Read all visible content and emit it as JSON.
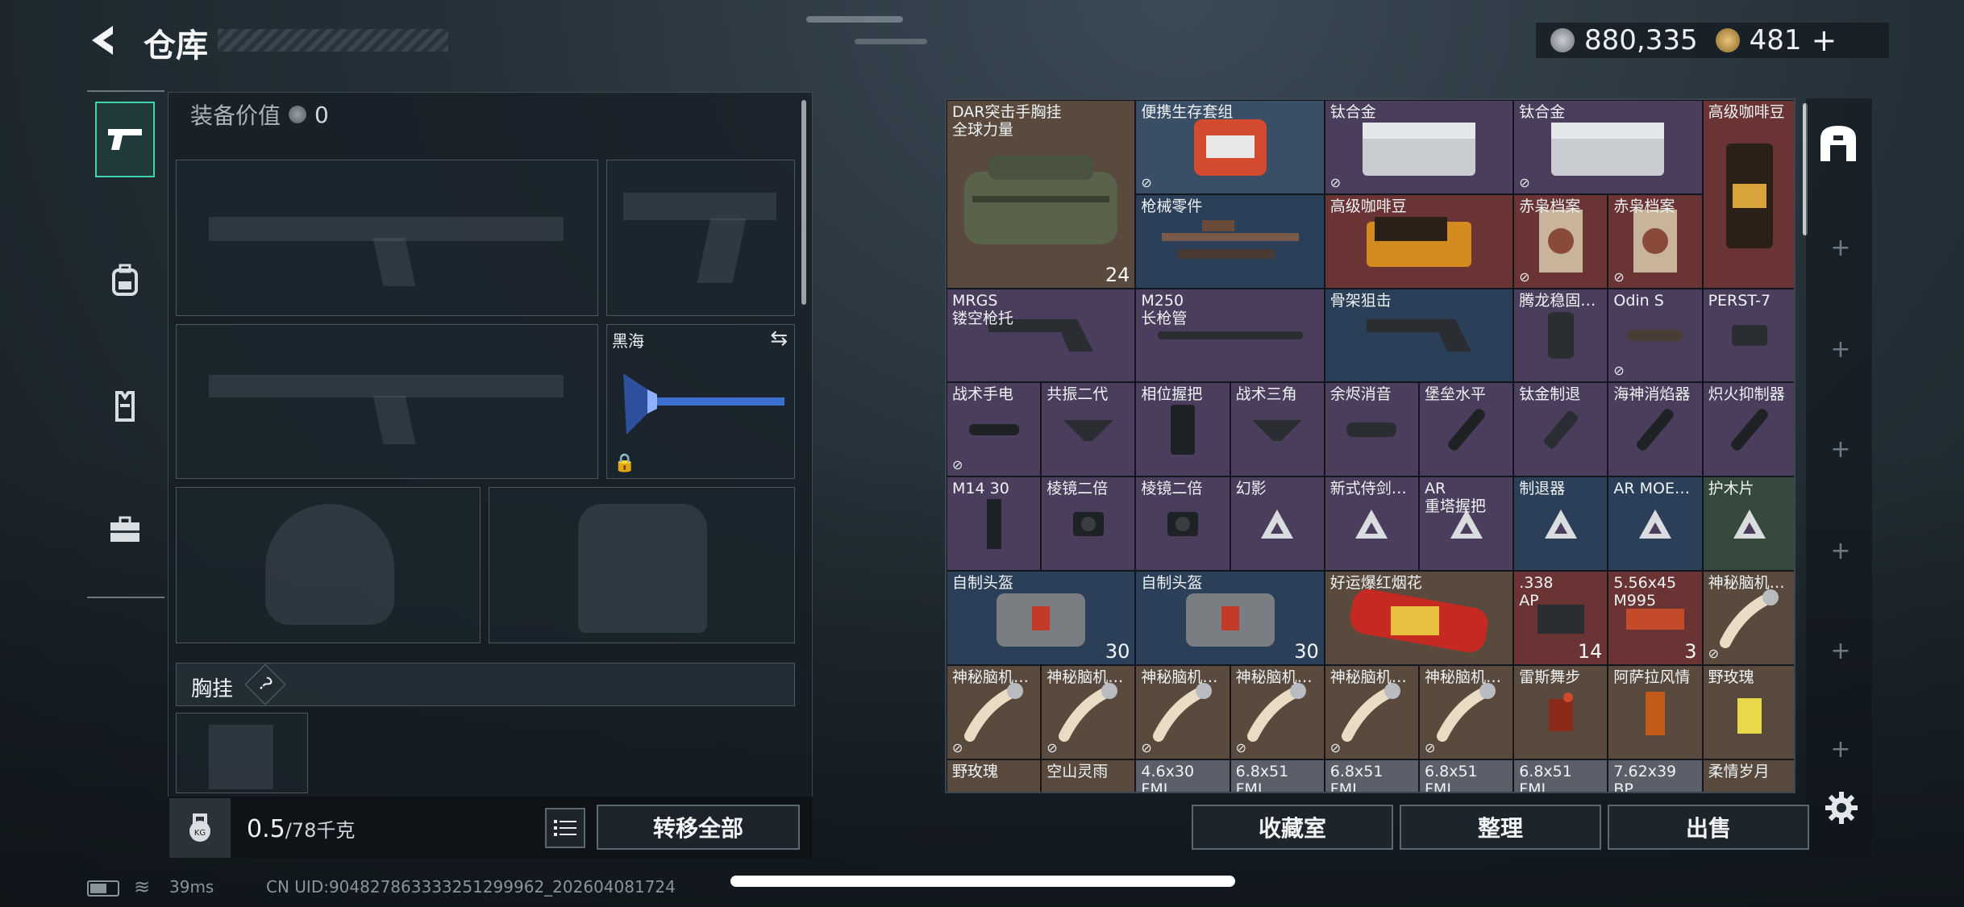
{
  "header": {
    "title": "仓库",
    "currency_silver": "880,335",
    "currency_gold": "481",
    "gold_add": "+"
  },
  "left": {
    "equip_value_label": "装备价值",
    "equip_value": "0",
    "melee_name": "黑海",
    "chest_rig_label": "胸挂",
    "help": "?",
    "weight_value": "0.5",
    "weight_max": "/78千克",
    "kg_label": "KG",
    "transfer_all": "转移全部"
  },
  "side_tabs": [
    "weapons-tab-icon",
    "backpack-tab-icon",
    "armor-tab-icon",
    "toolbox-tab-icon"
  ],
  "grid": {
    "cells": [
      {
        "name": "DAR突击手胸挂\n全球力量",
        "count": "24",
        "color": "brown",
        "icon": "bag"
      },
      {
        "name": "便携生存套组",
        "no_trade": true,
        "color": "blue",
        "icon": "kit"
      },
      {
        "name": "钛合金",
        "no_trade": true,
        "color": "purple",
        "icon": "plate"
      },
      {
        "name": "钛合金",
        "no_trade": true,
        "color": "purple",
        "icon": "plate"
      },
      {
        "name": "高级咖啡豆",
        "color": "red",
        "icon": "coffee"
      },
      {
        "name": "枪械零件",
        "color": "navy",
        "icon": "parts"
      },
      {
        "name": "高级咖啡豆",
        "color": "red",
        "icon": "coffee2"
      },
      {
        "name": "赤枭档案",
        "no_trade": true,
        "color": "red",
        "icon": "doc"
      },
      {
        "name": "赤枭档案",
        "no_trade": true,
        "color": "red",
        "icon": "doc"
      },
      {
        "name": "MRGS\n镂空枪托",
        "color": "purple",
        "icon": "stock"
      },
      {
        "name": "M250\n长枪管",
        "color": "purple",
        "icon": "barrel"
      },
      {
        "name": "骨架狙击",
        "color": "navy",
        "icon": "stock"
      },
      {
        "name": "腾龙稳固…",
        "color": "purple",
        "icon": "grip"
      },
      {
        "name": "Odin S",
        "no_trade": true,
        "color": "purple",
        "icon": "scope"
      },
      {
        "name": "PERST-7",
        "color": "purple",
        "icon": "laser"
      },
      {
        "name": "战术手电",
        "no_trade": true,
        "color": "purple",
        "icon": "light"
      },
      {
        "name": "共振二代",
        "color": "purple",
        "icon": "grip2"
      },
      {
        "name": "相位握把",
        "color": "purple",
        "icon": "vgrip"
      },
      {
        "name": "战术三角",
        "color": "purple",
        "icon": "grip2"
      },
      {
        "name": "余烬消音",
        "color": "purple",
        "icon": "supp"
      },
      {
        "name": "堡垒水平",
        "color": "purple",
        "icon": "suppl"
      },
      {
        "name": "钛金制退",
        "color": "purple",
        "icon": "brake"
      },
      {
        "name": "海神消焰器",
        "color": "purple",
        "icon": "suppl"
      },
      {
        "name": "炽火抑制器",
        "color": "purple",
        "icon": "suppl"
      },
      {
        "name": "M14 30",
        "color": "purple",
        "icon": "mag"
      },
      {
        "name": "棱镜二倍",
        "color": "purple",
        "icon": "optic"
      },
      {
        "name": "棱镜二倍",
        "color": "purple",
        "icon": "optic"
      },
      {
        "name": "幻影",
        "color": "purple",
        "icon": "tri"
      },
      {
        "name": "新式侍剑…",
        "color": "purple",
        "icon": "tri"
      },
      {
        "name": "AR\n重塔握把",
        "color": "purple",
        "icon": "tri"
      },
      {
        "name": "制退器",
        "color": "navy",
        "icon": "tri"
      },
      {
        "name": "AR MOE…",
        "color": "navy",
        "icon": "tri"
      },
      {
        "name": "护木片",
        "color": "green",
        "icon": "tri"
      },
      {
        "name": "自制头盔",
        "count": "30",
        "color": "navy",
        "icon": "helm"
      },
      {
        "name": "自制头盔",
        "count": "30",
        "color": "navy",
        "icon": "helm"
      },
      {
        "name": "好运爆红烟花",
        "color": "brown",
        "icon": "firework"
      },
      {
        "name": ".338\nAP",
        "count": "14",
        "color": "red",
        "icon": "ammo"
      },
      {
        "name": "5.56x45\nM995",
        "count": "3",
        "color": "red",
        "icon": "ammo2"
      },
      {
        "name": "神秘脑机…",
        "no_trade": true,
        "color": "brown",
        "icon": "chip"
      },
      {
        "name": "神秘脑机…",
        "no_trade": true,
        "color": "brown",
        "icon": "chip"
      },
      {
        "name": "神秘脑机…",
        "no_trade": true,
        "color": "brown",
        "icon": "chip"
      },
      {
        "name": "神秘脑机…",
        "no_trade": true,
        "color": "brown",
        "icon": "chip"
      },
      {
        "name": "神秘脑机…",
        "no_trade": true,
        "color": "brown",
        "icon": "chip"
      },
      {
        "name": "神秘脑机…",
        "no_trade": true,
        "color": "brown",
        "icon": "chip"
      },
      {
        "name": "神秘脑机…",
        "no_trade": true,
        "color": "brown",
        "icon": "chip"
      },
      {
        "name": "雷斯舞步",
        "color": "brown",
        "icon": "drink"
      },
      {
        "name": "阿萨拉风情",
        "color": "brown",
        "icon": "drink2"
      },
      {
        "name": "野玫瑰",
        "color": "brown",
        "icon": "drink3"
      },
      {
        "name": "野玫瑰",
        "color": "brown",
        "icon": "none"
      },
      {
        "name": "空山灵雨",
        "color": "brown",
        "icon": "none"
      },
      {
        "name": "4.6x30\nFMJ",
        "color": "gray",
        "icon": "none"
      },
      {
        "name": "6.8x51\nFMJ",
        "color": "gray",
        "icon": "none"
      },
      {
        "name": "6.8x51\nFMJ",
        "color": "gray",
        "icon": "none"
      },
      {
        "name": "6.8x51\nFMJ",
        "color": "gray",
        "icon": "none"
      },
      {
        "name": "6.8x51\nFMJ",
        "color": "gray",
        "icon": "none"
      },
      {
        "name": "7.62x39\nBP",
        "color": "gray",
        "icon": "none"
      },
      {
        "name": "柔情岁月",
        "color": "brown",
        "icon": "none"
      }
    ]
  },
  "buttons": {
    "collection": "收藏室",
    "organize": "整理",
    "sell": "出售"
  },
  "status": {
    "ping": "39ms",
    "uid": "CN UID:904827863333251299962_202604081724"
  }
}
